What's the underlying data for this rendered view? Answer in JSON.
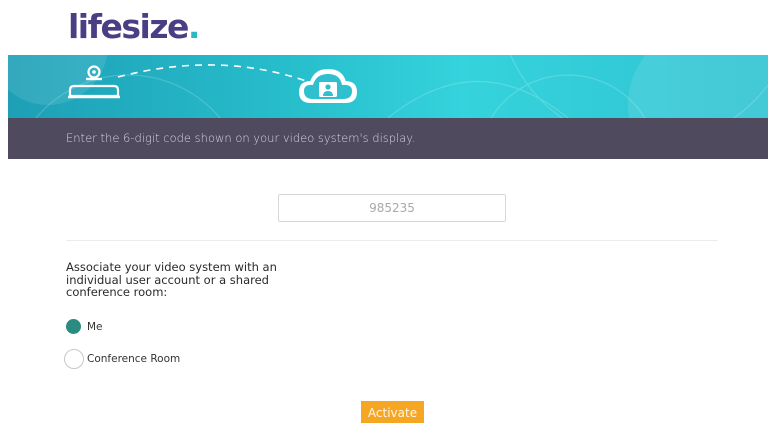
{
  "brand": {
    "logo_text": "lifesize",
    "logo_dot": ".",
    "logo_color": "#4a3e84",
    "accent_dot_color": "#2bb8c4"
  },
  "banner": {
    "device_icon": "video-system-icon",
    "cloud_icon": "cloud-user-icon",
    "colors": {
      "start": "#1e9fb6",
      "end": "#35d3dc"
    }
  },
  "instruction": {
    "text": "Enter the 6-digit code shown on your video system's display."
  },
  "code_field": {
    "value": "985235"
  },
  "association": {
    "prompt": "Associate your video system with an individual user account or a shared conference room:",
    "options": [
      {
        "label": "Me",
        "selected": true
      },
      {
        "label": "Conference Room",
        "selected": false
      }
    ],
    "selected_color": "#2a8c80"
  },
  "actions": {
    "activate_label": "Activate",
    "activate_color": "#f5a623"
  }
}
